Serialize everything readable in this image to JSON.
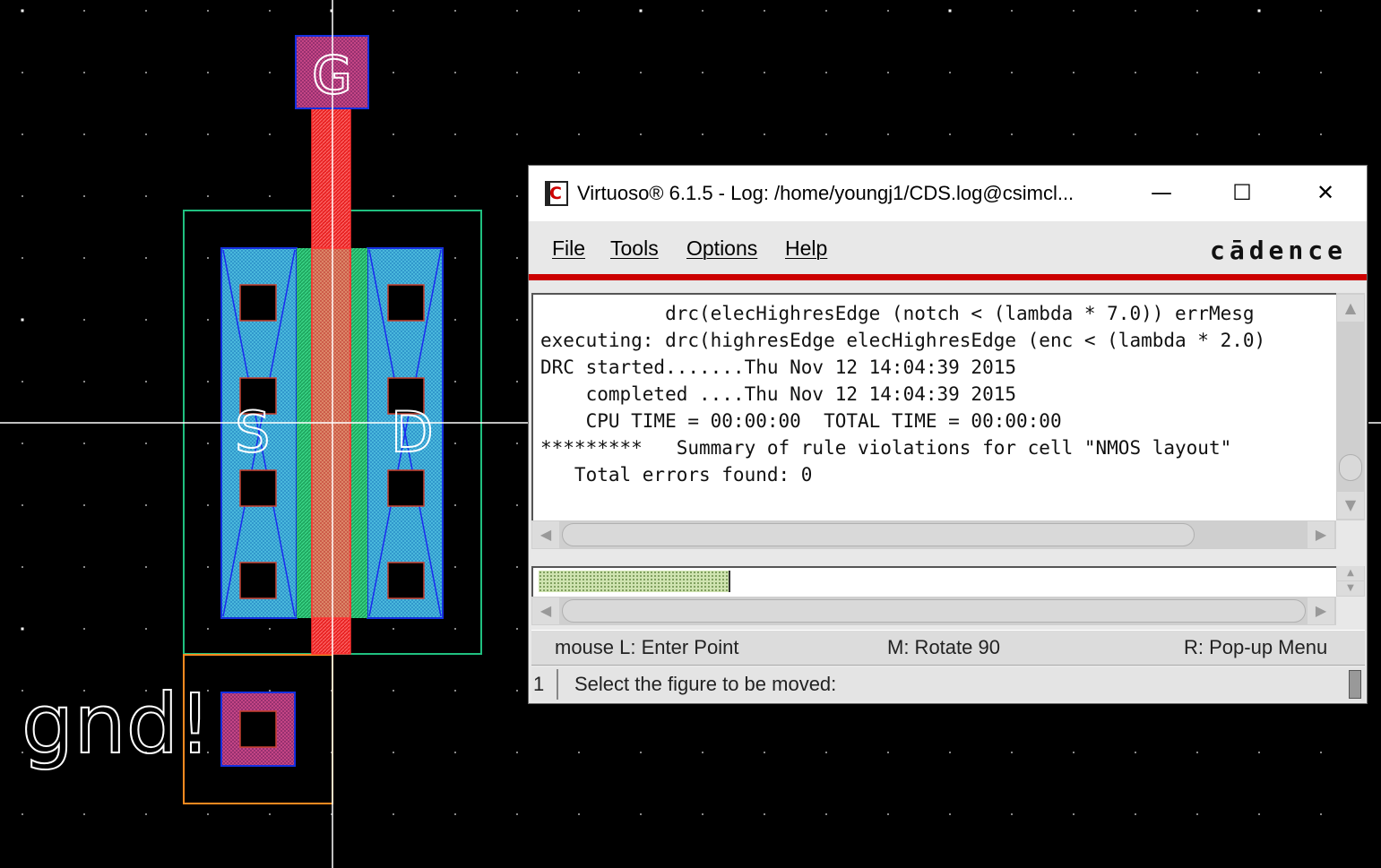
{
  "layout": {
    "pins": {
      "gate": "G",
      "source": "S",
      "drain": "D"
    },
    "net_label": "gnd!",
    "colors": {
      "background": "#000000",
      "poly": "#ff2a2a",
      "diffusion": "#2fbf7a",
      "metal1": "#2aa0d8",
      "metal_outline": "#1530e0",
      "contact": "#000000",
      "well": "#20c080",
      "pin_box": "#ff8a20",
      "crosshair": "#ffffff"
    }
  },
  "window": {
    "title": "Virtuoso® 6.1.5 - Log: /home/youngj1/CDS.log@csimcl...",
    "icon": "cadence-c-icon",
    "controls": {
      "minimize": "—",
      "maximize": "☐",
      "close": "✕"
    },
    "menu": [
      "File",
      "Tools",
      "Options",
      "Help"
    ],
    "brand": "cādence",
    "log_lines": [
      "           drc(elecHighresEdge (notch < (lambda * 7.0)) errMesg",
      "executing: drc(highresEdge elecHighresEdge (enc < (lambda * 2.0)",
      "DRC started.......Thu Nov 12 14:04:39 2015",
      "    completed ....Thu Nov 12 14:04:39 2015",
      "    CPU TIME = 00:00:00  TOTAL TIME = 00:00:00",
      "*********   Summary of rule violations for cell \"NMOS layout\"",
      "   Total errors found: 0"
    ],
    "status": {
      "left": "mouse L: Enter Point",
      "middle": "M: Rotate 90",
      "right": "R: Pop-up Menu"
    },
    "prompt": {
      "number": "1",
      "text": "Select the figure to be moved:"
    }
  }
}
